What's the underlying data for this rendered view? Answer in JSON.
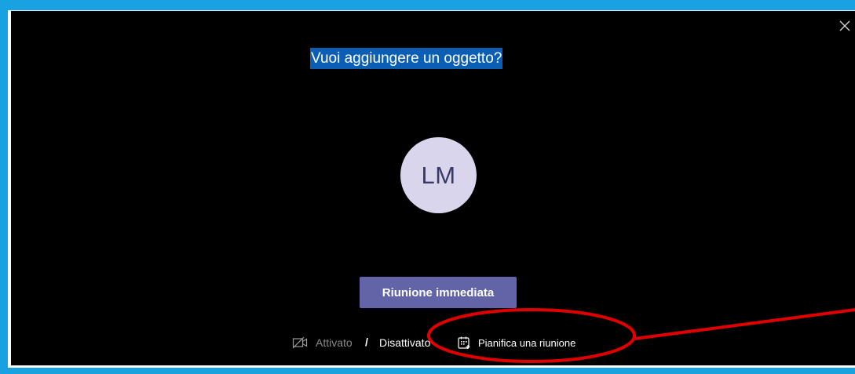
{
  "dialog": {
    "subject_label": "Vuoi aggiungere un oggetto?",
    "avatar_initials": "LM",
    "meet_now_label": "Riunione immediata",
    "video_on_label": "Attivato",
    "separator": "/",
    "video_off_label": "Disattivato",
    "schedule_label": "Pianifica una riunione",
    "close_icon": "close-icon",
    "video_icon": "video-off-icon",
    "calendar_icon": "calendar-icon"
  },
  "colors": {
    "frame": "#19a2e2",
    "background": "#000000",
    "subject_highlight": "#0a5fb4",
    "avatar_bg": "#d8d5ec",
    "avatar_text": "#3a3a66",
    "button": "#6264a7",
    "annotation": "#e00000"
  }
}
